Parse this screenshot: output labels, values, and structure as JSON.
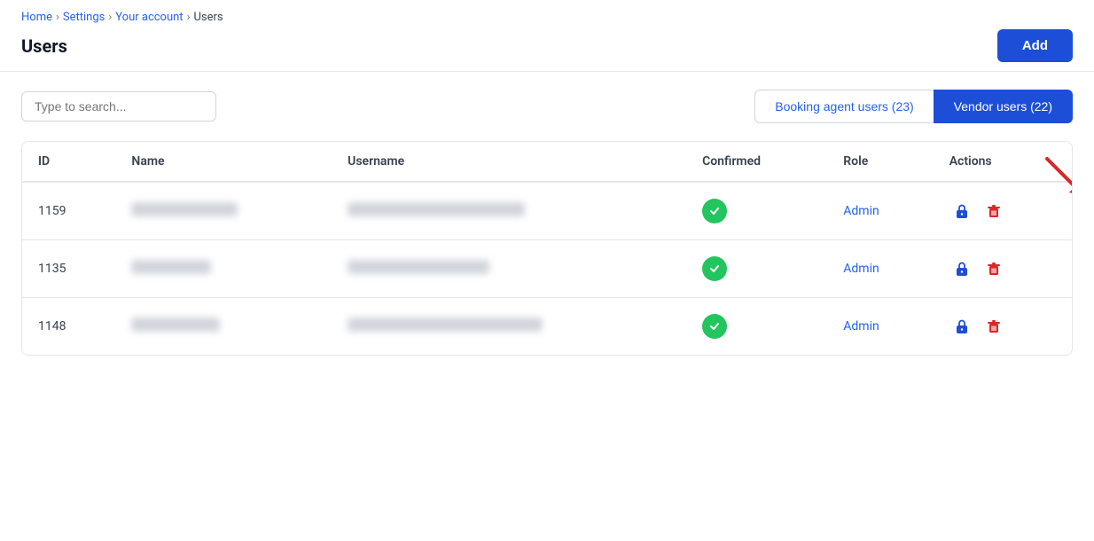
{
  "breadcrumb": {
    "items": [
      "Home",
      "Settings",
      "Your account",
      "Users"
    ]
  },
  "header": {
    "title": "Users",
    "add_button": "Add"
  },
  "search": {
    "placeholder": "Type to search..."
  },
  "tabs": [
    {
      "label": "Booking agent users (23)",
      "active": false
    },
    {
      "label": "Vendor users (22)",
      "active": true
    }
  ],
  "table": {
    "columns": [
      "ID",
      "Name",
      "Username",
      "Confirmed",
      "Role",
      "Actions"
    ],
    "rows": [
      {
        "id": "1159",
        "name_blur_w": 120,
        "username_blur_w": 200,
        "confirmed": true,
        "role": "Admin"
      },
      {
        "id": "1135",
        "name_blur_w": 90,
        "username_blur_w": 160,
        "confirmed": true,
        "role": "Admin"
      },
      {
        "id": "1148",
        "name_blur_w": 100,
        "username_blur_w": 220,
        "confirmed": true,
        "role": "Admin"
      }
    ]
  },
  "icons": {
    "lock": "🔒",
    "trash": "🗑",
    "check": "✓",
    "chevron": "›"
  }
}
